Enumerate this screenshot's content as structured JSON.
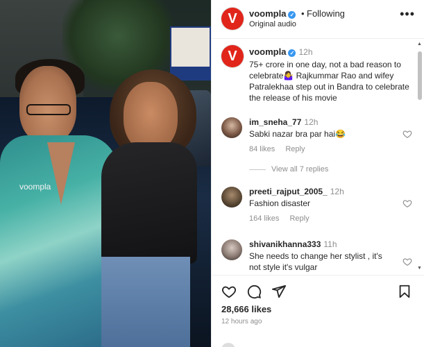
{
  "post": {
    "watermark": "voompla"
  },
  "header": {
    "avatar_letter": "V",
    "username": "voompla",
    "separator": "•",
    "follow_label": "Following",
    "audio": "Original audio",
    "more": "•••"
  },
  "caption": {
    "avatar_letter": "V",
    "username": "voompla",
    "time": "12h",
    "text": "75+ crore in one day, not a bad reason to celebrate🤷‍♀️ Rajkummar Rao and wifey Patralekhaa step out in Bandra to celebrate the release of his movie"
  },
  "comments": [
    {
      "username": "im_sneha_77",
      "time": "12h",
      "text": "Sabki nazar bra par hai😂",
      "likes": "84 likes",
      "reply": "Reply",
      "view_replies": "View all 7 replies"
    },
    {
      "username": "preeti_rajput_2005_",
      "time": "12h",
      "text": "Fashion disaster",
      "likes": "164 likes",
      "reply": "Reply"
    },
    {
      "username": "shivanikhanna333",
      "time": "11h",
      "text": "She needs to change her stylist , it's not style it's vulgar"
    }
  ],
  "actions": {
    "likes": "28,666 likes",
    "time_ago": "12 hours ago"
  },
  "icons": [
    "heart-icon",
    "comment-icon",
    "share-icon",
    "bookmark-icon",
    "verified-icon",
    "more-icon"
  ],
  "colors": {
    "brand_red": "#e1251b",
    "verified_blue": "#3897f0",
    "muted_text": "#8e8e8e"
  }
}
